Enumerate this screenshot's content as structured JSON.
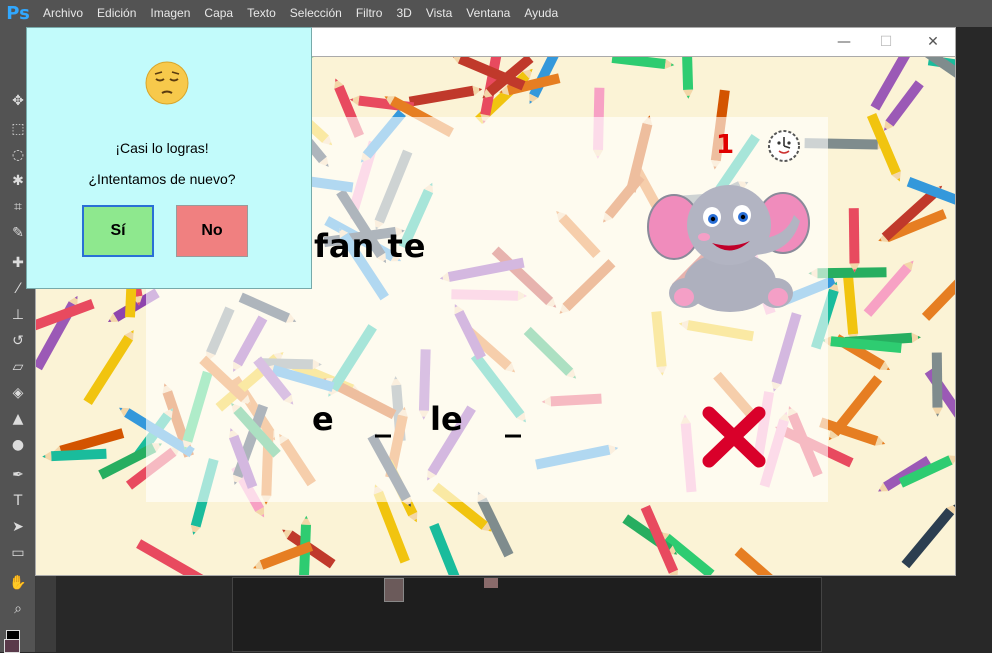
{
  "app": {
    "logo": "Ps"
  },
  "menu": [
    "Archivo",
    "Edición",
    "Imagen",
    "Capa",
    "Texto",
    "Selección",
    "Filtro",
    "3D",
    "Vista",
    "Ventana",
    "Ayuda"
  ],
  "window": {
    "minimize": "—",
    "maximize": "☐",
    "close": "✕"
  },
  "game": {
    "word_syllables": "fan te",
    "blanks": [
      "e",
      "_",
      "le",
      "_"
    ],
    "score": "1",
    "icons": {
      "clock": "clock-icon",
      "elephant": "elephant-image",
      "wrong_mark": "wrong-x-icon"
    },
    "colors": {
      "score": "#e00000",
      "wrong_mark": "#d9002a"
    }
  },
  "dialog": {
    "emoji": "pensive-face-icon",
    "line1": "¡Casi lo logras!",
    "line2": "¿Intentamos de nuevo?",
    "yes_label": "Sí",
    "no_label": "No",
    "colors": {
      "background": "#c2fbfb",
      "yes": "#8ee88e",
      "no": "#f08080"
    }
  }
}
